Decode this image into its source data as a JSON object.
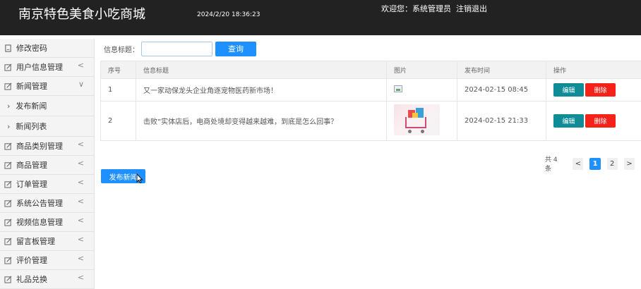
{
  "header": {
    "title": "南京特色美食小吃商城",
    "datetime": "2024/2/20 18:36:23",
    "welcome": "欢迎您：系统管理员",
    "logout": "注销退出"
  },
  "sidebar": {
    "items": [
      {
        "label": "修改密码",
        "icon": "lock-icon"
      },
      {
        "label": "用户信息管理",
        "icon": "edit-icon",
        "chevron": "<"
      },
      {
        "label": "新闻管理",
        "icon": "edit-icon",
        "chevron": "∨"
      },
      {
        "label": "商品类别管理",
        "icon": "edit-icon",
        "chevron": "<"
      },
      {
        "label": "商品管理",
        "icon": "edit-icon",
        "chevron": "<"
      },
      {
        "label": "订单管理",
        "icon": "edit-icon",
        "chevron": "<"
      },
      {
        "label": "系统公告管理",
        "icon": "edit-icon",
        "chevron": "<"
      },
      {
        "label": "视频信息管理",
        "icon": "edit-icon",
        "chevron": "<"
      },
      {
        "label": "留言板管理",
        "icon": "edit-icon",
        "chevron": "<"
      },
      {
        "label": "评价管理",
        "icon": "edit-icon",
        "chevron": "<"
      },
      {
        "label": "礼品兑换",
        "icon": "edit-icon",
        "chevron": "<"
      }
    ],
    "subitems": [
      {
        "label": "发布新闻",
        "arrow": "›"
      },
      {
        "label": "新闻列表",
        "arrow": "›"
      }
    ]
  },
  "search": {
    "label": "信息标题：",
    "value": "",
    "button": "查询"
  },
  "table": {
    "headers": [
      "序号",
      "信息标题",
      "图片",
      "发布时间",
      "操作"
    ],
    "rows": [
      {
        "no": "1",
        "title": "又一家动保龙头企业角逐宠物医药新市场！",
        "image": "broken",
        "time": "2024-02-15 08:45",
        "edit": "编辑",
        "delete": "删除"
      },
      {
        "no": "2",
        "title": "击败”实体店后，电商处境却变得越来越难，到底是怎么回事？",
        "image": "shopping-cart-photo",
        "time": "2024-02-15 21:33",
        "edit": "编辑",
        "delete": "删除"
      }
    ]
  },
  "pager": {
    "total": "共 4 条",
    "prev": "<",
    "pages": [
      "1",
      "2"
    ],
    "current": 1,
    "next": ">"
  },
  "publish_button": "发布新闻",
  "colors": {
    "header_bg": "#222222",
    "primary": "#1e90ff",
    "edit": "#108c96",
    "delete": "#f5221a"
  }
}
